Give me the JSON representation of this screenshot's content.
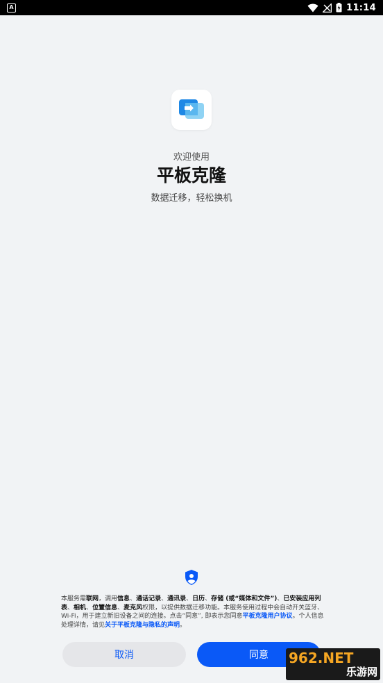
{
  "status_bar": {
    "notification": "A",
    "time": "11:14"
  },
  "app": {
    "welcome": "欢迎使用",
    "title": "平板克隆",
    "tagline": "数据迁移，轻松换机"
  },
  "privacy": {
    "p1": "本服务需",
    "b1": "联网",
    "p2": "，调用",
    "b2": "信息",
    "p3": "、",
    "b3": "通话记录",
    "p4": "、",
    "b4": "通讯录",
    "p5": "、",
    "b5": "日历",
    "p6": "、",
    "b6": "存储 (或“媒体和文件”)",
    "p7": "、",
    "b7": "已安装应用列表",
    "p8": "、",
    "b8": "相机",
    "p9": "、",
    "b9": "位置信息",
    "p10": "、",
    "b10": "麦克风",
    "p11": "权限，以提供数据迁移功能。本服务使用过程中会自动开关蓝牙、Wi-Fi，用于建立新旧设备之间的连接。点击“同意”, 即表示您同意",
    "link1": "平板克隆用户协议",
    "p12": "。个人信息处理详情，请见",
    "link2": "关于平板克隆与隐私的声明",
    "p13": "。"
  },
  "buttons": {
    "cancel": "取消",
    "agree": "同意"
  },
  "watermark": {
    "top": "962.NET",
    "bottom": "乐游网"
  },
  "colors": {
    "accent": "#0a59f7",
    "background": "#f1f3f5"
  }
}
